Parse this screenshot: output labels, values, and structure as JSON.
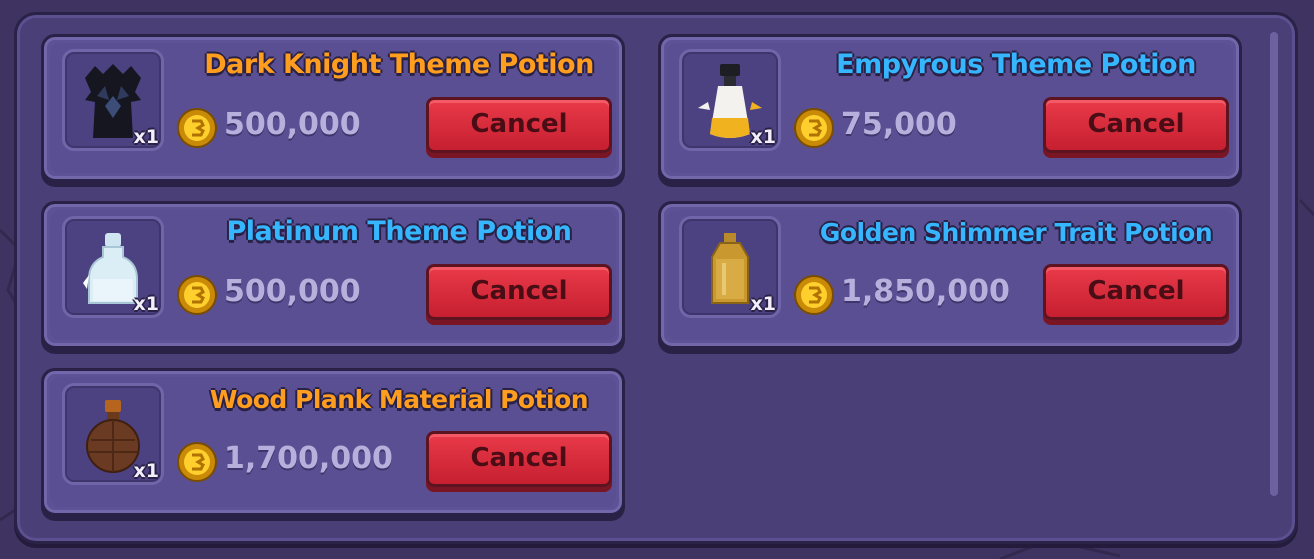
{
  "listings": [
    {
      "title": "Dark Knight Theme Potion",
      "title_color": "#ff9d1f",
      "price": "500,000",
      "quantity": "x1",
      "cancel_label": "Cancel",
      "icon": "dark-knight-potion-icon"
    },
    {
      "title": "Empyrous Theme Potion",
      "title_color": "#35b6ff",
      "price": "75,000",
      "quantity": "x1",
      "cancel_label": "Cancel",
      "icon": "empyrous-potion-icon"
    },
    {
      "title": "Platinum Theme Potion",
      "title_color": "#35b6ff",
      "price": "500,000",
      "quantity": "x1",
      "cancel_label": "Cancel",
      "icon": "platinum-potion-icon"
    },
    {
      "title": "Golden Shimmer Trait Potion",
      "title_color": "#35b6ff",
      "price": "1,850,000",
      "quantity": "x1",
      "cancel_label": "Cancel",
      "icon": "golden-shimmer-potion-icon"
    },
    {
      "title": "Wood Plank Material Potion",
      "title_color": "#ff9d1f",
      "price": "1,700,000",
      "quantity": "x1",
      "cancel_label": "Cancel",
      "icon": "wood-plank-potion-icon"
    }
  ],
  "colors": {
    "cancel_button": "#dd2e3e",
    "panel": "#4a3f76",
    "card": "#5d5296",
    "price_text": "#b8b0dc"
  }
}
